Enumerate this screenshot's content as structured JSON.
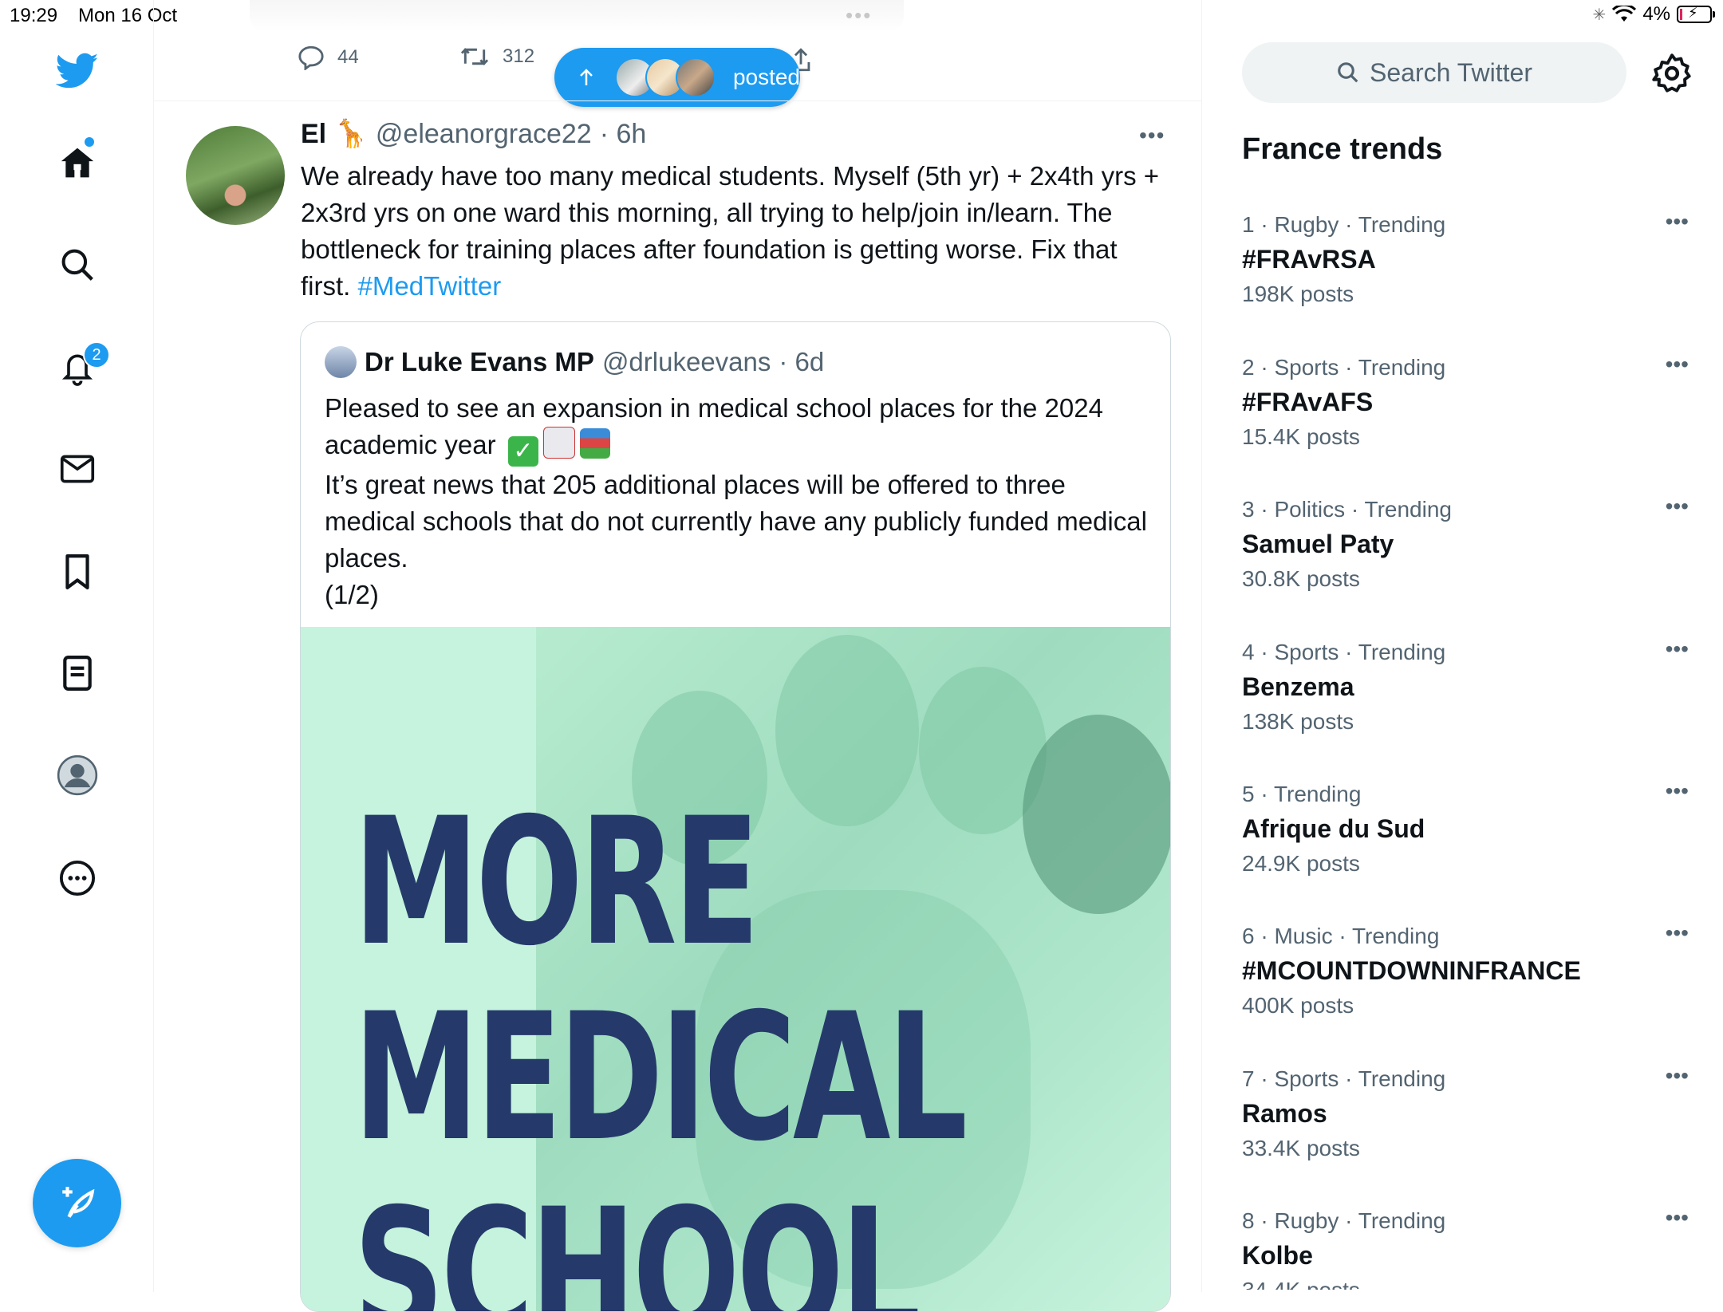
{
  "status_bar": {
    "time": "19:29",
    "date": "Mon 16 Oct",
    "battery": "4%"
  },
  "nav": {
    "notifications_badge": "2"
  },
  "prev_tweet": {
    "reply_count": "44",
    "retweet_count": "312"
  },
  "posted_pill": {
    "label": "posted"
  },
  "tweet": {
    "name": "El 🦒",
    "handle": "@eleanorgrace22",
    "time": "· 6h",
    "text": "We already have too many medical students. Myself (5th yr) + 2x4th yrs + 2x3rd yrs on one ward this morning, all trying to help/join in/learn. The bottleneck for training places after foundation is getting worse. Fix that first. ",
    "hashtag": "#MedTwitter"
  },
  "quote": {
    "name": "Dr Luke Evans MP",
    "handle": "@drlukeevans",
    "time": "· 6d",
    "line1": "Pleased to see an expansion in medical school places for the 2024",
    "line2": "academic year",
    "line3": "It’s great news that 205 additional places will be offered to three medical schools that do not currently have any publicly funded medical places.",
    "line4": "(1/2)",
    "image_text": [
      "MORE",
      "MEDICAL",
      "SCHOOL"
    ]
  },
  "search": {
    "placeholder": "Search Twitter"
  },
  "trends": {
    "title": "France trends",
    "items": [
      {
        "meta": "1 · Rugby · Trending",
        "name": "#FRAvRSA",
        "count": "198K posts"
      },
      {
        "meta": "2 · Sports · Trending",
        "name": "#FRAvAFS",
        "count": "15.4K posts"
      },
      {
        "meta": "3 · Politics · Trending",
        "name": "Samuel Paty",
        "count": "30.8K posts"
      },
      {
        "meta": "4 · Sports · Trending",
        "name": "Benzema",
        "count": "138K posts"
      },
      {
        "meta": "5 · Trending",
        "name": "Afrique du Sud",
        "count": "24.9K posts"
      },
      {
        "meta": "6 · Music · Trending",
        "name": "#MCOUNTDOWNINFRANCE",
        "count": "400K posts"
      },
      {
        "meta": "7 · Sports · Trending",
        "name": "Ramos",
        "count": "33.4K posts"
      },
      {
        "meta": "8 · Rugby · Trending",
        "name": "Kolbe",
        "count": "34.4K posts"
      }
    ]
  },
  "colors": {
    "accent": "#1d9bf0",
    "text": "#0f1419",
    "muted": "#536471",
    "image_bg": "#c5f3dd",
    "image_text": "#253a6b"
  }
}
